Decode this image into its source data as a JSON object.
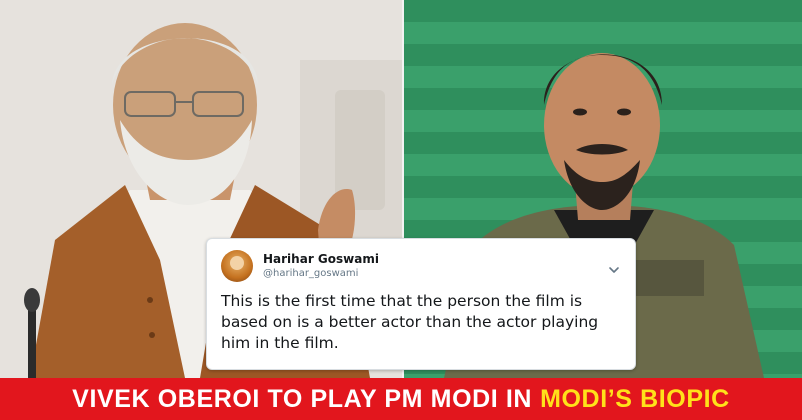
{
  "tweet": {
    "display_name": "Harihar Goswami",
    "handle": "@harihar_goswami",
    "text": "This is the first time that the person the film is based on is a better actor than the actor playing him in the film."
  },
  "caption": {
    "main": "VIVEK OBEROI TO PLAY PM MODI IN",
    "highlight": "MODI’S BIOPIC"
  },
  "colors": {
    "caption_bg": "#e2161d",
    "caption_text": "#ffffff",
    "caption_highlight": "#ffe11a",
    "right_panel_green": "#3aa06b"
  },
  "icons": [
    "chevron-down-icon"
  ]
}
